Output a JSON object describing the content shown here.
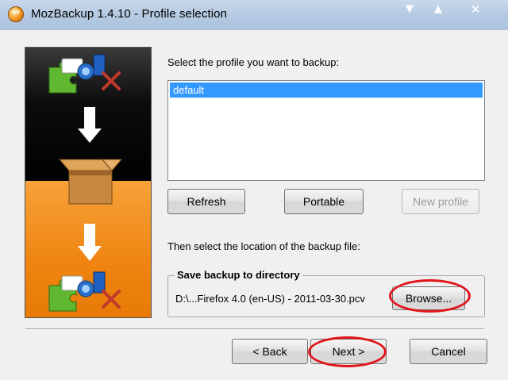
{
  "window": {
    "title": "MozBackup 1.4.10 - Profile selection",
    "controls": {
      "minimize": "▼",
      "maximize": "▲",
      "close": "✕"
    }
  },
  "main": {
    "select_profile_label": "Select the profile you want to backup:",
    "profiles": [
      {
        "name": "default",
        "selected": true
      }
    ],
    "buttons": {
      "refresh": "Refresh",
      "portable": "Portable",
      "new_profile": "New profile"
    },
    "location_label": "Then select the location of the backup file:",
    "save_group": {
      "title": "Save backup to directory",
      "path": "D:\\...Firefox 4.0 (en-US) - 2011-03-30.pcv",
      "browse": "Browse..."
    }
  },
  "footer": {
    "back": "< Back",
    "next": "Next >",
    "cancel": "Cancel"
  },
  "colors": {
    "selection": "#3399ff",
    "annotation_red": "#e0151b",
    "banner_orange": "#ef8410",
    "banner_black": "#000000"
  }
}
